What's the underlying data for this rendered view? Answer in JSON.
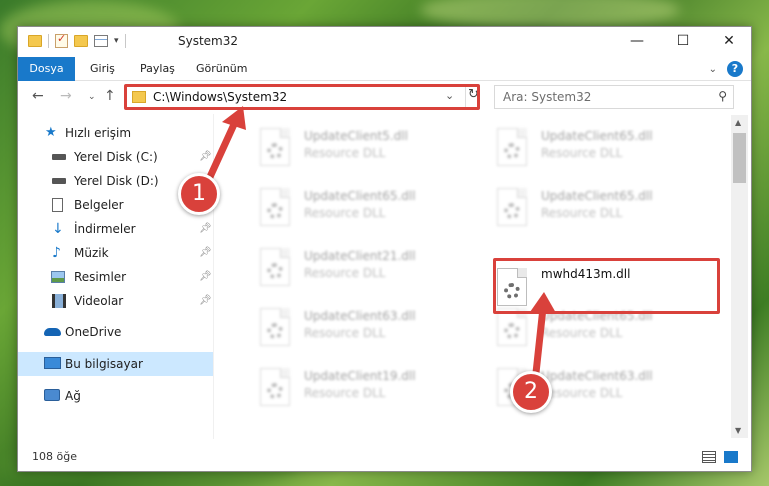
{
  "titlebar": {
    "title": "System32",
    "minimize_icon": "minimize-icon",
    "maximize_icon": "maximize-icon",
    "close_icon": "close-icon"
  },
  "ribbon": {
    "tabs": [
      "Dosya",
      "Giriş",
      "Paylaş",
      "Görünüm"
    ],
    "accent": "#1979ca"
  },
  "address": {
    "path": "C:\\Windows\\System32",
    "search_placeholder": "Ara: System32"
  },
  "sidebar": {
    "items": [
      {
        "label": "Hızlı erişim",
        "icon": "star-icon",
        "pinned": false
      },
      {
        "label": "Yerel Disk (C:)",
        "icon": "drive-icon",
        "pinned": true
      },
      {
        "label": "Yerel Disk (D:)",
        "icon": "drive-icon",
        "pinned": false
      },
      {
        "label": "Belgeler",
        "icon": "document-icon",
        "pinned": false
      },
      {
        "label": "İndirmeler",
        "icon": "download-icon",
        "pinned": true
      },
      {
        "label": "Müzik",
        "icon": "music-icon",
        "pinned": true
      },
      {
        "label": "Resimler",
        "icon": "pictures-icon",
        "pinned": true
      },
      {
        "label": "Videolar",
        "icon": "video-icon",
        "pinned": true
      },
      {
        "label": "OneDrive",
        "icon": "cloud-icon",
        "pinned": false
      },
      {
        "label": "Bu bilgisayar",
        "icon": "computer-icon",
        "pinned": false,
        "selected": true
      },
      {
        "label": "Ağ",
        "icon": "network-icon",
        "pinned": false
      }
    ]
  },
  "files": [
    {
      "name": "UpdateClient5.dll",
      "type": "Resource DLL"
    },
    {
      "name": "UpdateClient65.dll",
      "type": "Resource DLL"
    },
    {
      "name": "UpdateClient65.dll",
      "type": "Resource DLL"
    },
    {
      "name": "UpdateClient65.dll",
      "type": "Resource DLL"
    },
    {
      "name": "UpdateClient21.dll",
      "type": "Resource DLL"
    },
    {
      "name": "mwhd413m.dll",
      "type": ""
    },
    {
      "name": "UpdateClient63.dll",
      "type": "Resource DLL"
    },
    {
      "name": "UpdateClient65.dll",
      "type": "Resource DLL"
    },
    {
      "name": "UpdateClient19.dll",
      "type": "Resource DLL"
    },
    {
      "name": "UpdateClient63.dll",
      "type": "Resource DLL"
    }
  ],
  "status": {
    "count": "108 öğe"
  },
  "callouts": [
    "1",
    "2"
  ],
  "highlight_color": "#d9413b"
}
